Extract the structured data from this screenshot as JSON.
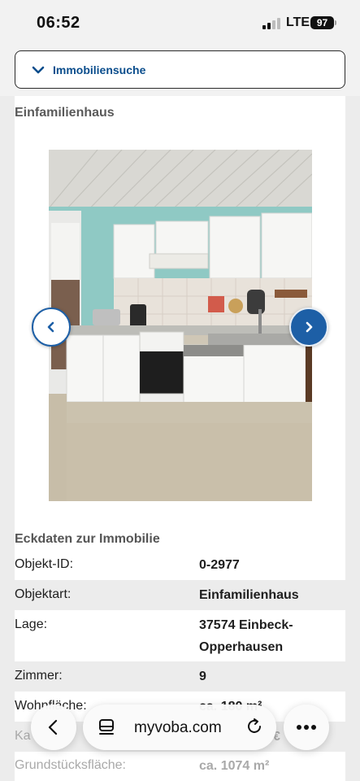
{
  "status_bar": {
    "time": "06:52",
    "network": "LTE",
    "battery": "97"
  },
  "nav": {
    "search_label": "Immobiliensuche",
    "chevron_icon": "chevron-down-icon"
  },
  "listing": {
    "subtitle": "Einfamilienhaus"
  },
  "gallery": {
    "prev_icon": "chevron-left-icon",
    "next_icon": "chevron-right-icon"
  },
  "details": {
    "title": "Eckdaten zur Immobilie",
    "rows": [
      {
        "key": "Objekt-ID:",
        "value": "0-2977"
      },
      {
        "key": "Objektart:",
        "value": "Einfamilienhaus"
      },
      {
        "key": "Lage:",
        "value": "37574 Einbeck-Opperhausen"
      },
      {
        "key": "Zimmer:",
        "value": "9"
      },
      {
        "key": "Wohnfläche:",
        "value": "ca. 180 m²"
      },
      {
        "key": "Ka",
        "value": "€"
      },
      {
        "key": "Grundstücksfläche:",
        "value": "ca. 1074 m²"
      }
    ]
  },
  "browser": {
    "url": "myvoba.com",
    "back_icon": "chevron-left-icon",
    "tabs_icon": "page-menu-icon",
    "reload_icon": "reload-icon",
    "more_icon": "more-dots-icon"
  },
  "colors": {
    "accent": "#1d5fa6",
    "link": "#0a4d8c"
  }
}
